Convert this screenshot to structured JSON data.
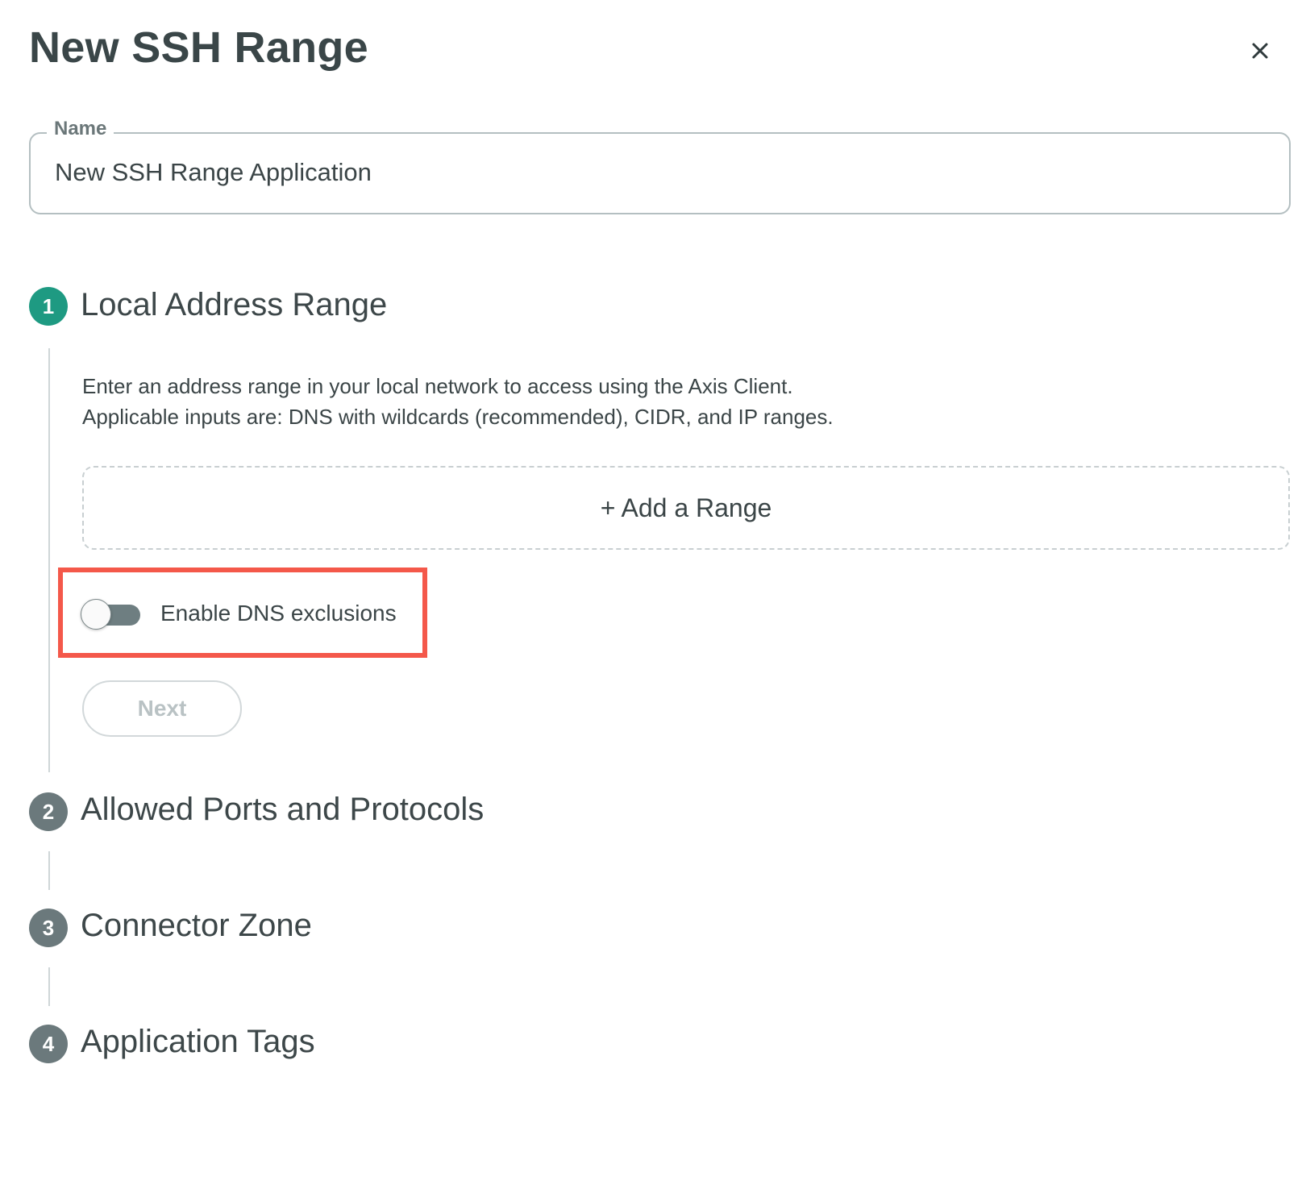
{
  "dialog": {
    "title": "New SSH Range",
    "close_icon": "close-icon"
  },
  "name_field": {
    "label": "Name",
    "value": "New SSH Range Application"
  },
  "steps": [
    {
      "number": "1",
      "title": "Local Address Range",
      "state": "active",
      "description": [
        "Enter an address range in your local network to access using the Axis Client.",
        "Applicable inputs are: DNS with wildcards (recommended), CIDR, and IP ranges."
      ],
      "add_range_label": "+ Add a Range",
      "toggle": {
        "label": "Enable DNS exclusions",
        "on": false
      },
      "next_label": "Next"
    },
    {
      "number": "2",
      "title": "Allowed Ports and Protocols",
      "state": "inactive"
    },
    {
      "number": "3",
      "title": "Connector Zone",
      "state": "inactive"
    },
    {
      "number": "4",
      "title": "Application Tags",
      "state": "inactive"
    }
  ],
  "colors": {
    "active_step": "#1e9a82",
    "inactive_step": "#6b797c",
    "highlight": "#f4584a"
  }
}
